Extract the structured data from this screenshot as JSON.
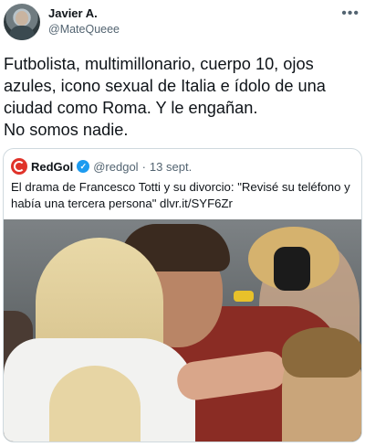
{
  "tweet": {
    "author_name": "Javier A.",
    "author_handle": "@MateQueee",
    "more_icon": "more-horizontal-icon",
    "text_lines": [
      "Futbolista, multimillonario, cuerpo 10, ojos",
      "azules, icono sexual de Italia e ídolo de una",
      "ciudad como Roma. Y le engañan.",
      "No somos nadie."
    ]
  },
  "quoted_tweet": {
    "author_name": "RedGol",
    "verified_icon": "verified-badge-icon",
    "author_handle": "@redgol",
    "separator": "·",
    "date": "13 sept.",
    "text": "El drama de Francesco Totti y su divorcio: \"Revisé su teléfono y había una tercera persona\" dlvr.it/SYF6Zr",
    "photo": "photo-totti-embrace"
  },
  "colors": {
    "text": "#0f1419",
    "secondary": "#536471",
    "border": "#cfd9de",
    "verified": "#1d9bf0",
    "redgol": "#e0332a"
  }
}
